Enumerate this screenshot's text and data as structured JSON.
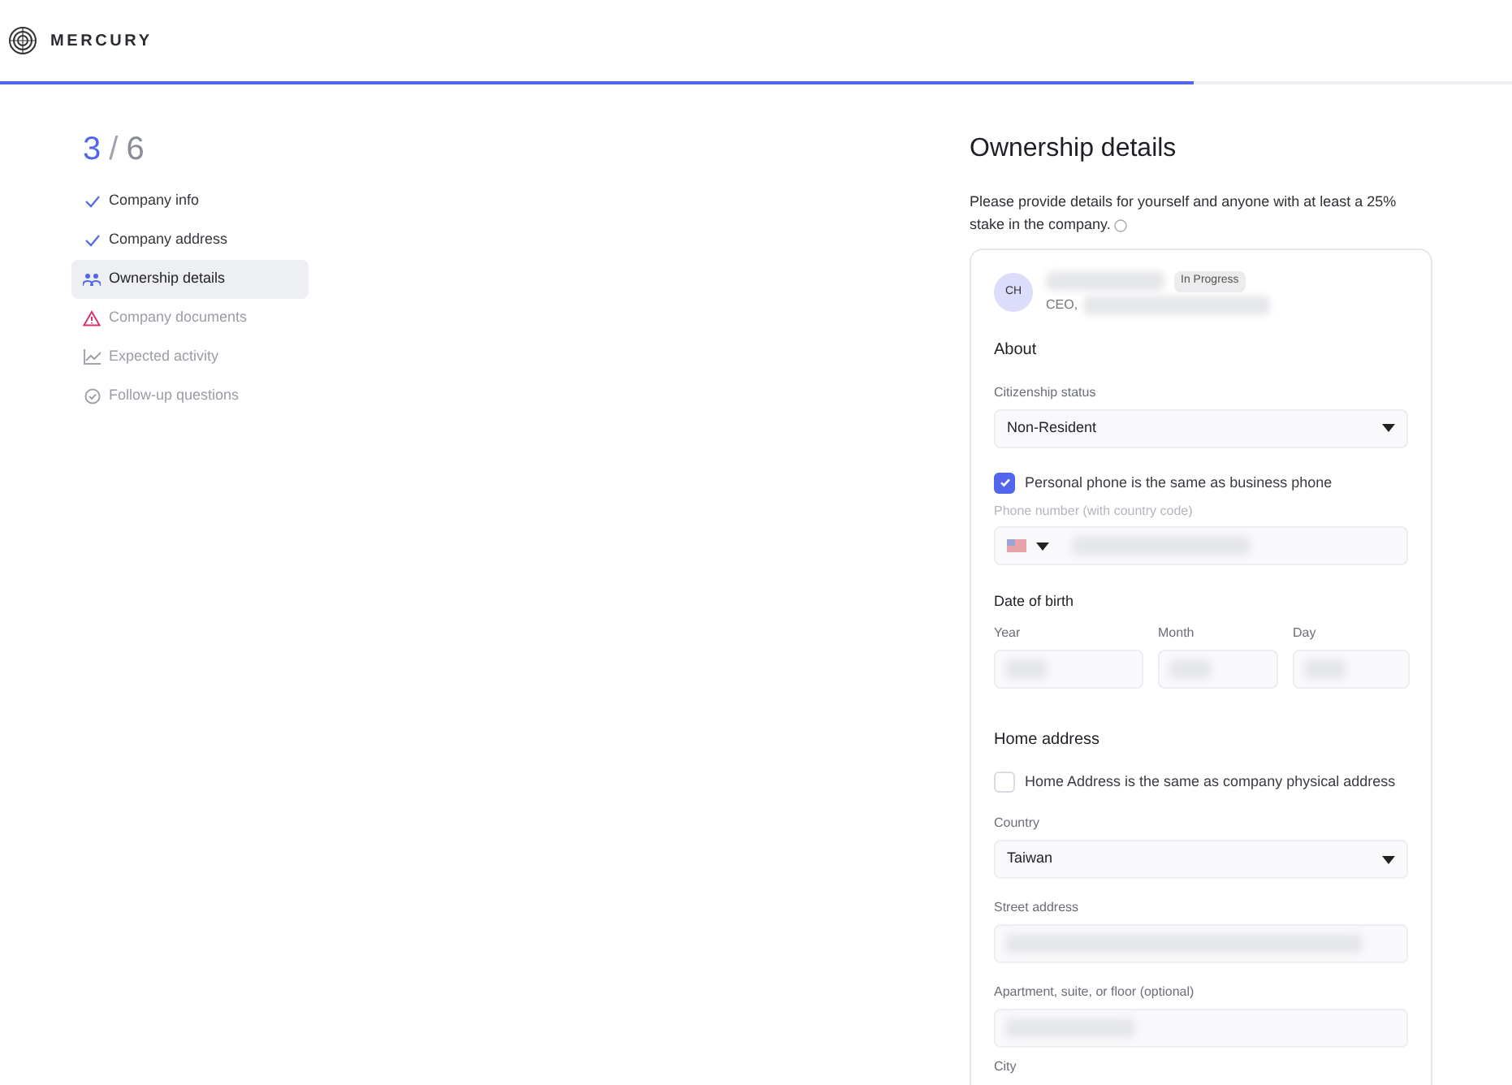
{
  "brand": {
    "name": "MERCURY"
  },
  "progress": {
    "level": 0.79
  },
  "stepper": {
    "current": "3",
    "separator": "/",
    "total": "6"
  },
  "steps": [
    {
      "label": "Company info",
      "kind": "done",
      "selected": false
    },
    {
      "label": "Company address",
      "kind": "done",
      "selected": false
    },
    {
      "label": "Ownership details",
      "kind": "people",
      "selected": true
    },
    {
      "label": "Company documents",
      "kind": "warning",
      "selected": false
    },
    {
      "label": "Expected activity",
      "kind": "chart",
      "selected": false
    },
    {
      "label": "Follow-up questions",
      "kind": "pending",
      "selected": false
    }
  ],
  "form": {
    "title": "Ownership details",
    "description": "Please provide details for yourself and anyone with at least a 25% stake in the company.",
    "owner": {
      "initials": "CH",
      "status": "In Progress",
      "role": "CEO,"
    },
    "about": {
      "heading": "About",
      "citizenship": {
        "label": "Citizenship status",
        "value": "Non-Resident"
      },
      "same_phone": {
        "label": "Personal phone is the same as business phone",
        "checked": true
      },
      "phone": {
        "label": "Phone number (with country code)"
      },
      "dob": {
        "heading": "Date of birth",
        "fields": [
          "Year",
          "Month",
          "Day"
        ]
      }
    },
    "home": {
      "heading": "Home address",
      "same_address": {
        "label": "Home Address is the same as company physical address",
        "checked": false
      },
      "country": {
        "label": "Country",
        "value": "Taiwan"
      },
      "street": {
        "label": "Street address"
      },
      "apartment": {
        "label": "Apartment, suite, or floor (optional)"
      },
      "city": {
        "label": "City"
      }
    }
  }
}
